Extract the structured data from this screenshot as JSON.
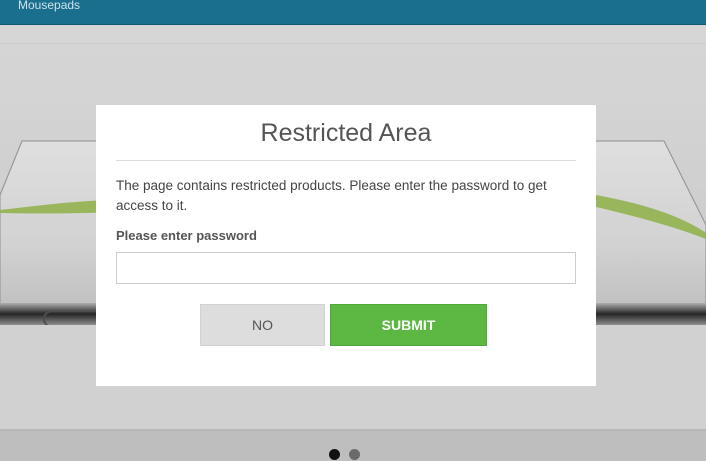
{
  "topbar": {
    "link_label": "Mousepads"
  },
  "slider": {
    "image_icon": "mousepad-product-image",
    "dot_count": 2,
    "active_dot": 1
  },
  "modal": {
    "title": "Restricted Area",
    "message": "The page contains restricted products. Please enter the password to get access to it.",
    "field_label": "Please enter password",
    "password_value": "",
    "no_label": "NO",
    "submit_label": "SUBMIT"
  },
  "colors": {
    "topbar": "#1a6f8f",
    "submit": "#5cb842",
    "no": "#dddddd"
  }
}
